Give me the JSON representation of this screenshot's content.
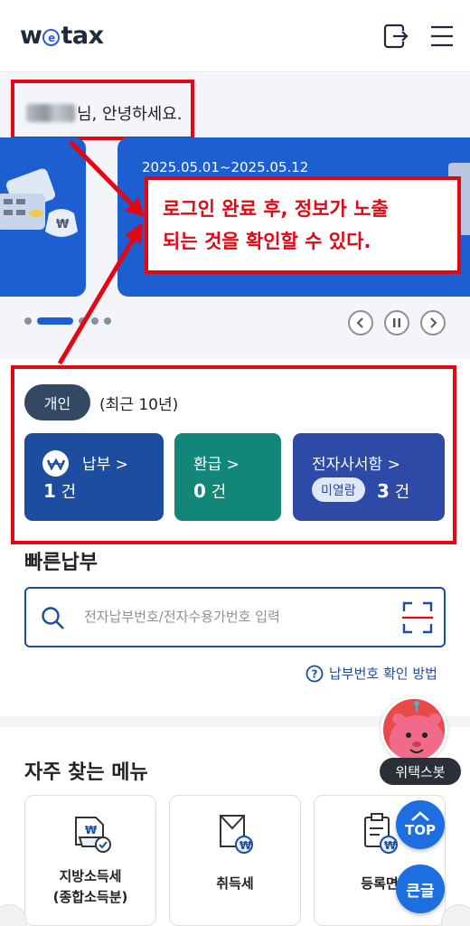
{
  "header": {
    "logo_prefix": "w",
    "logo_circle": "e",
    "logo_suffix": "tax",
    "icons": [
      "logout-icon",
      "hamburger-menu-icon"
    ]
  },
  "greeting": {
    "suffix": "님, 안녕하세요."
  },
  "banner": {
    "date_range": "2025.05.01~2025.05.12"
  },
  "callout": {
    "line1": "로그인 완료 후, 정보가 노출",
    "line2": "되는 것을 확인할 수 있다."
  },
  "status": {
    "type_pill": "개인",
    "period": "(최근 10년)",
    "cards": [
      {
        "title": "납부 >",
        "count": "1",
        "unit": "건"
      },
      {
        "title": "환급 >",
        "count": "0",
        "unit": "건"
      },
      {
        "title": "전자사서함 >",
        "badge": "미열람",
        "count": "3",
        "unit": "건"
      }
    ]
  },
  "quick_pay": {
    "title": "빠른납부",
    "placeholder": "전자납부번호/전자수용가번호 입력",
    "help": "납부번호 확인 방법"
  },
  "frequent_menu": {
    "title": "자주 찾는 메뉴",
    "items": [
      {
        "line1": "지방소득세",
        "line2": "(종합소득분)"
      },
      {
        "line1": "취득세",
        "line2": ""
      },
      {
        "line1": "등록면",
        "line2": ""
      }
    ]
  },
  "floating": {
    "bot_label": "위택스봇",
    "top_label": "TOP",
    "big_text_label": "큰글"
  },
  "colors": {
    "accent_red": "#e30613",
    "brand_blue": "#1d5fd1",
    "pay_card": "#1c4d9e",
    "refund_card": "#13867a",
    "notice_card": "#2c4aa6"
  }
}
